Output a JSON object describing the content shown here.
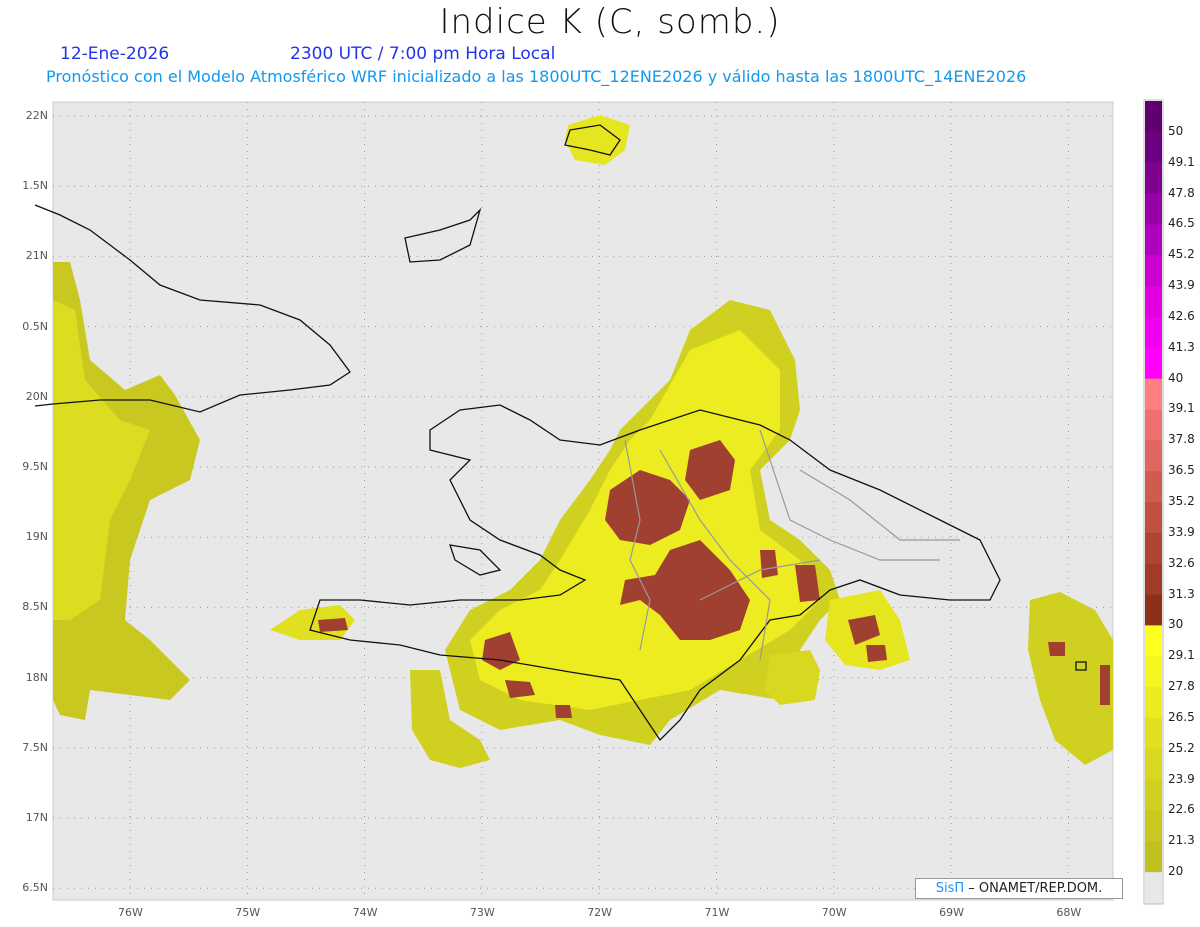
{
  "header": {
    "title": "Indice K (C, somb.)",
    "date": "12-Ene-2026",
    "time": "2300 UTC / 7:00 pm Hora Local",
    "subtitle": "Pronóstico con el Modelo Atmosférico WRF inicializado a las 1800UTC_12ENE2026 y válido hasta las  1800UTC_14ENE2026"
  },
  "axes": {
    "lat_labels": [
      "22N",
      "1.5N",
      "21N",
      "0.5N",
      "20N",
      "9.5N",
      "19N",
      "8.5N",
      "18N",
      "7.5N",
      "17N",
      "6.5N"
    ],
    "lon_labels": [
      "76W",
      "75W",
      "74W",
      "73W",
      "72W",
      "71W",
      "70W",
      "69W",
      "68W"
    ]
  },
  "colorbar": {
    "labels": [
      "50",
      "49.1",
      "47.8",
      "46.5",
      "45.2",
      "43.9",
      "42.6",
      "41.3",
      "40",
      "39.1",
      "37.8",
      "36.5",
      "35.2",
      "33.9",
      "32.6",
      "31.3",
      "30",
      "29.1",
      "27.8",
      "26.5",
      "25.2",
      "23.9",
      "22.6",
      "21.3",
      "20"
    ],
    "colors": [
      "#600070",
      "#6c0080",
      "#800090",
      "#9800a8",
      "#b000c0",
      "#cc00d0",
      "#e000e0",
      "#f000f0",
      "#ff00ff",
      "#ff8080",
      "#f07070",
      "#e06660",
      "#d05c50",
      "#c05040",
      "#b04434",
      "#a03c28",
      "#8c3018",
      "#ffff20",
      "#f5f520",
      "#ebeb20",
      "#e0e020",
      "#d8d820",
      "#d0d020",
      "#c8c820",
      "#c0c020",
      "#e8e8e8"
    ]
  },
  "credit": {
    "brand": "SisΠ",
    "text": "– ONAMET/REP.DOM."
  }
}
